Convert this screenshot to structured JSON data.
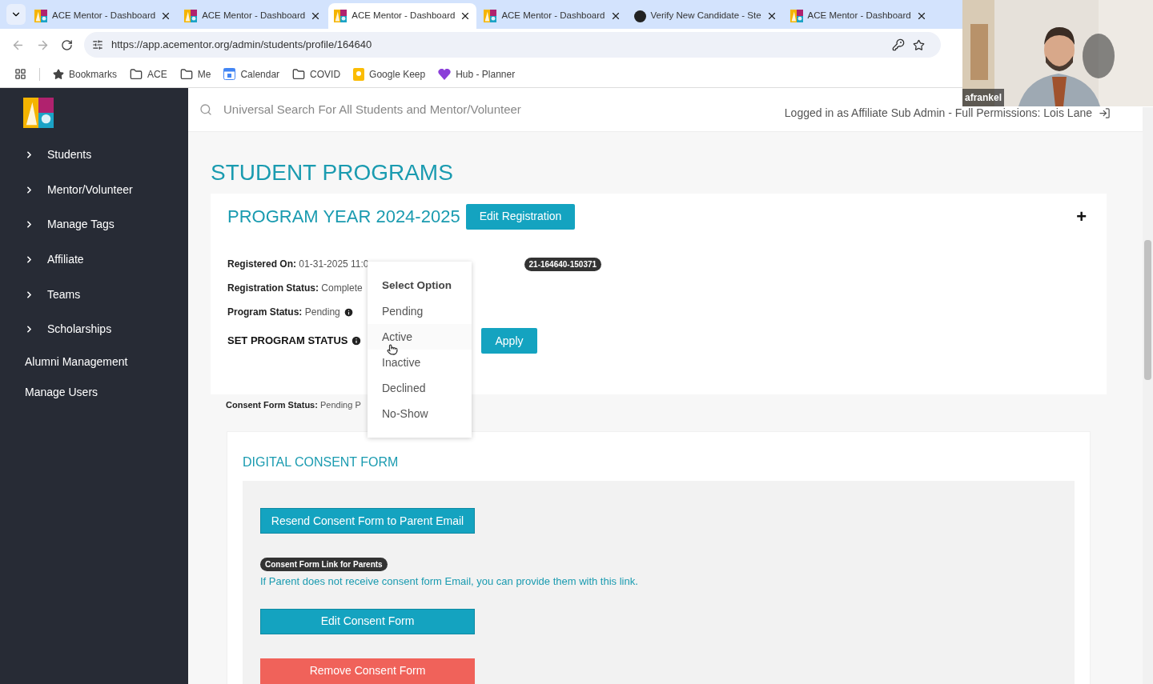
{
  "browser": {
    "tabs": [
      {
        "title": "ACE Mentor - Dashboard",
        "kind": "ace",
        "selected": false
      },
      {
        "title": "ACE Mentor - Dashboard",
        "kind": "ace",
        "selected": false
      },
      {
        "title": "ACE Mentor - Dashboard",
        "kind": "ace",
        "selected": true
      },
      {
        "title": "ACE Mentor - Dashboard",
        "kind": "ace",
        "selected": false
      },
      {
        "title": "Verify New Candidate - Ste",
        "kind": "other",
        "selected": false
      },
      {
        "title": "ACE Mentor - Dashboard",
        "kind": "ace",
        "selected": false
      }
    ],
    "url": "https://app.acementor.org/admin/students/profile/164640",
    "bookmarks": [
      {
        "label": "Bookmarks",
        "kind": "star"
      },
      {
        "label": "ACE",
        "kind": "folder"
      },
      {
        "label": "Me",
        "kind": "folder"
      },
      {
        "label": "Calendar",
        "kind": "calendar"
      },
      {
        "label": "COVID",
        "kind": "folder"
      },
      {
        "label": "Google Keep",
        "kind": "keep"
      },
      {
        "label": "Hub - Planner",
        "kind": "hub"
      }
    ]
  },
  "video": {
    "name": "afrankel"
  },
  "sidebar": {
    "items": [
      {
        "label": "Students",
        "expandable": true
      },
      {
        "label": "Mentor/Volunteer",
        "expandable": true
      },
      {
        "label": "Manage Tags",
        "expandable": true
      },
      {
        "label": "Affiliate",
        "expandable": true
      },
      {
        "label": "Teams",
        "expandable": true
      },
      {
        "label": "Scholarships",
        "expandable": true
      },
      {
        "label": "Alumni Management",
        "expandable": false
      },
      {
        "label": "Manage Users",
        "expandable": false
      }
    ]
  },
  "header": {
    "search_placeholder": "Universal Search For All Students and Mentor/Volunteer",
    "logged_in": "Logged in as Affiliate Sub Admin - Full Permissions: Lois Lane"
  },
  "page_title": "STUDENT PROGRAMS",
  "program": {
    "title": "PROGRAM YEAR 2024-2025",
    "edit_button": "Edit Registration",
    "plus": "+",
    "fields": [
      {
        "label": "Registered On:",
        "value": "01-31-2025 11:0",
        "info": false
      },
      {
        "label": "Registration Status:",
        "value": "Complete",
        "info": false
      },
      {
        "label": "Program Status:",
        "value": "Pending",
        "info": true
      }
    ],
    "id_badge": "21-164640-150371",
    "set_status_label": "SET PROGRAM STATUS",
    "apply_button": "Apply",
    "dropdown": {
      "options": [
        {
          "label": "Select Option",
          "kind": "header",
          "hovered": false
        },
        {
          "label": "Pending",
          "kind": "option",
          "hovered": false
        },
        {
          "label": "Active",
          "kind": "option",
          "hovered": true
        },
        {
          "label": "Inactive",
          "kind": "option",
          "hovered": false
        },
        {
          "label": "Declined",
          "kind": "option",
          "hovered": false
        },
        {
          "label": "No-Show",
          "kind": "option",
          "hovered": false
        }
      ]
    },
    "consent_status": {
      "label": "Consent Form Status:",
      "value": "Pending P"
    }
  },
  "consent": {
    "title": "DIGITAL CONSENT FORM",
    "resend_button": "Resend Consent Form to Parent Email",
    "link_badge": "Consent Form Link for Parents",
    "link_note": "If Parent does not receive consent form Email, you can provide them with this link.",
    "edit_button": "Edit Consent Form",
    "remove_button": "Remove Consent Form"
  }
}
